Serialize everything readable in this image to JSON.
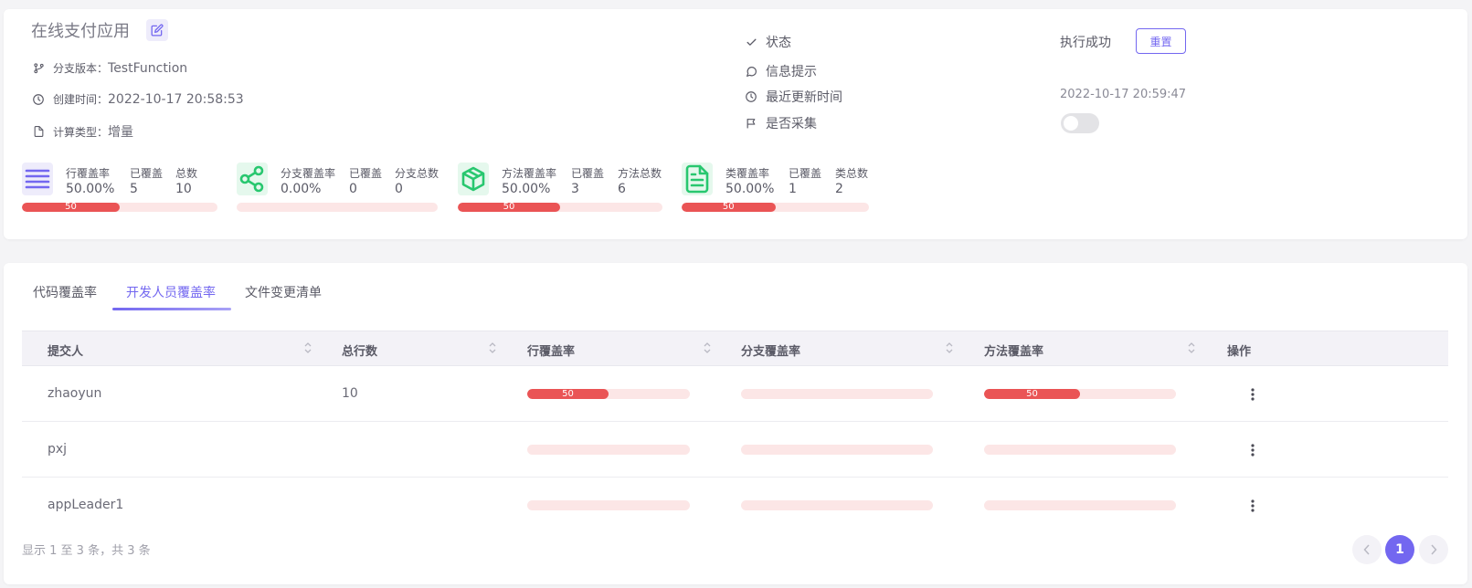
{
  "header": {
    "app_name": "在线支付应用",
    "branch_label": "分支版本：",
    "branch_value": "TestFunction",
    "created_label": "创建时间：",
    "created_value": "2022-10-17 20:58:53",
    "calc_label": "计算类型：",
    "calc_value": "增量"
  },
  "status": {
    "state_label": "状态",
    "state_value": "执行成功",
    "reset_label": "重置",
    "info_label": "信息提示",
    "updated_label": "最近更新时间",
    "updated_value": "2022-10-17 20:59:47",
    "collect_label": "是否采集",
    "collect_enabled": false
  },
  "metrics": [
    {
      "icon": "lines-icon",
      "color": "#7367f0",
      "rate_label": "行覆盖率",
      "rate": "50.00%",
      "covered_label": "已覆盖",
      "covered": "5",
      "total_label": "总数",
      "total": "10",
      "percent": 50,
      "bar_text": "50"
    },
    {
      "icon": "share-icon",
      "color": "#28c76f",
      "rate_label": "分支覆盖率",
      "rate": "0.00%",
      "covered_label": "已覆盖",
      "covered": "0",
      "total_label": "分支总数",
      "total": "0",
      "percent": 0,
      "bar_text": ""
    },
    {
      "icon": "box-icon",
      "color": "#28c76f",
      "rate_label": "方法覆盖率",
      "rate": "50.00%",
      "covered_label": "已覆盖",
      "covered": "3",
      "total_label": "方法总数",
      "total": "6",
      "percent": 50,
      "bar_text": "50"
    },
    {
      "icon": "document-icon",
      "color": "#28c76f",
      "rate_label": "类覆盖率",
      "rate": "50.00%",
      "covered_label": "已覆盖",
      "covered": "1",
      "total_label": "类总数",
      "total": "2",
      "percent": 50,
      "bar_text": "50"
    }
  ],
  "tabs": [
    {
      "label": "代码覆盖率",
      "active": false
    },
    {
      "label": "开发人员覆盖率",
      "active": true
    },
    {
      "label": "文件变更清单",
      "active": false
    }
  ],
  "table": {
    "columns": [
      "提交人",
      "总行数",
      "行覆盖率",
      "分支覆盖率",
      "方法覆盖率",
      "操作"
    ],
    "rows": [
      {
        "name": "zhaoyun",
        "lines": "10",
        "line_pct": 50,
        "line_text": "50",
        "branch_pct": 0,
        "branch_text": "",
        "method_pct": 50,
        "method_text": "50"
      },
      {
        "name": "pxj",
        "lines": "",
        "line_pct": 0,
        "line_text": "",
        "branch_pct": 0,
        "branch_text": "",
        "method_pct": 0,
        "method_text": ""
      },
      {
        "name": "appLeader1",
        "lines": "",
        "line_pct": 0,
        "line_text": "",
        "branch_pct": 0,
        "branch_text": "",
        "method_pct": 0,
        "method_text": ""
      }
    ]
  },
  "pagination": {
    "summary": "显示 1 至 3 条，共 3 条",
    "current_page": "1"
  }
}
